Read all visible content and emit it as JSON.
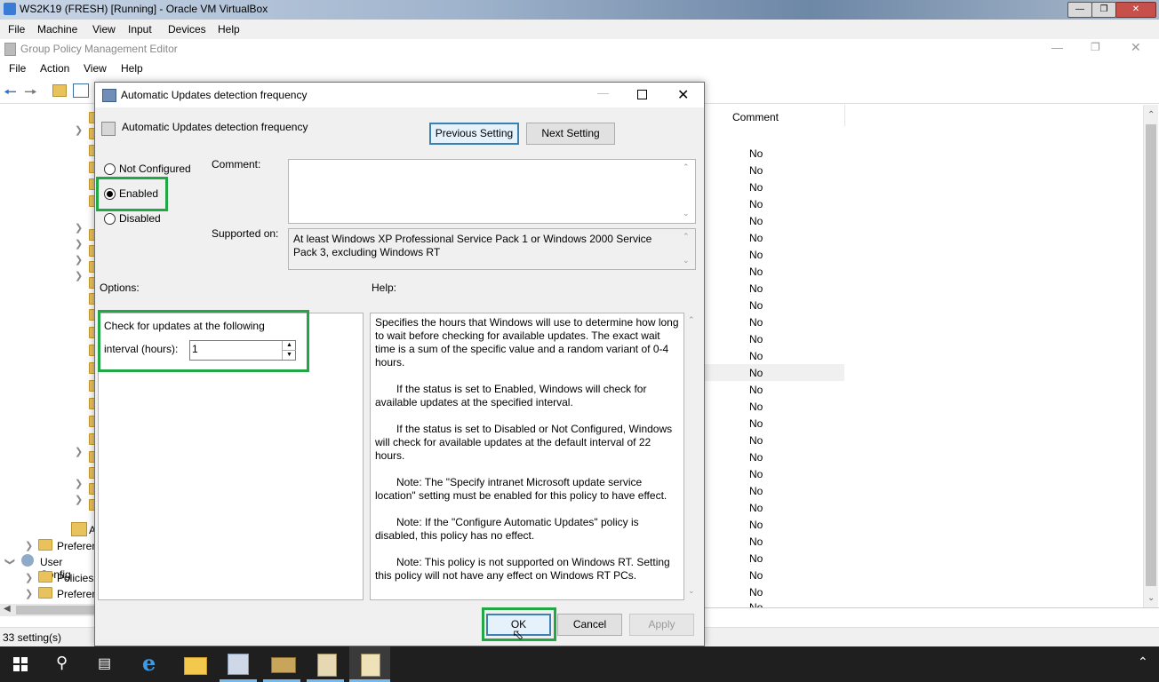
{
  "vbox": {
    "title": "WS2K19 (FRESH) [Running] - Oracle VM VirtualBox",
    "menu": [
      "File",
      "Machine",
      "View",
      "Input",
      "Devices",
      "Help"
    ]
  },
  "gpme": {
    "title": "Group Policy Management Editor",
    "menu": [
      "File",
      "Action",
      "View",
      "Help"
    ],
    "tree_items": [
      "A",
      "Preferen",
      "User Config",
      "Policies",
      "Preferen"
    ],
    "comment_header": "Comment",
    "no_rows": [
      "No",
      "No",
      "No",
      "No",
      "No",
      "No",
      "No",
      "No",
      "No",
      "No",
      "No",
      "No",
      "No",
      "No",
      "No",
      "No",
      "No",
      "No",
      "No",
      "No",
      "No",
      "No",
      "No",
      "No",
      "No",
      "No",
      "No",
      "No"
    ],
    "status": "33 setting(s)"
  },
  "dialog": {
    "title": "Automatic Updates detection frequency",
    "header_title": "Automatic Updates detection frequency",
    "prev_button": "Previous Setting",
    "next_button": "Next Setting",
    "radios": {
      "not_configured": "Not Configured",
      "enabled": "Enabled",
      "disabled": "Disabled",
      "selected": "enabled"
    },
    "comment_label": "Comment:",
    "comment_value": "",
    "supported_label": "Supported on:",
    "supported_value": "At least Windows XP Professional Service Pack 1 or Windows 2000 Service Pack 3, excluding Windows RT",
    "options_label": "Options:",
    "help_label": "Help:",
    "option_text_line1": "Check for updates at the following",
    "option_text_line2": "interval (hours):",
    "interval_value": "1",
    "help_paragraphs": [
      "Specifies the hours that Windows will use to determine how long to wait before checking for available updates. The exact wait time is a sum of the specific value and a random variant of 0-4 hours.",
      "If the status is set to Enabled, Windows will check for available updates at the specified interval.",
      "If the status is set to Disabled or Not Configured, Windows will check for available updates at the default interval of 22 hours.",
      "Note: The \"Specify intranet Microsoft update service location\" setting must be enabled for this policy to have effect.",
      "Note: If the \"Configure Automatic Updates\" policy is disabled, this policy has no effect.",
      "Note: This policy is not supported on Windows RT. Setting this policy will not have any effect on Windows RT PCs."
    ],
    "ok_button": "OK",
    "cancel_button": "Cancel",
    "apply_button": "Apply"
  },
  "colors": {
    "highlight": "#21a745",
    "taskbar": "#1f1f1f"
  }
}
